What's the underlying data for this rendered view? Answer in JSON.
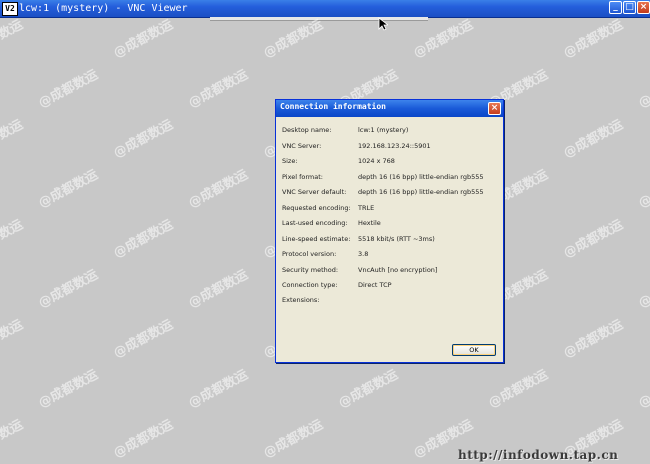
{
  "window": {
    "app_icon_text": "V2",
    "title": "lcw:1 (mystery) - VNC Viewer",
    "buttons": {
      "minimize": "_",
      "maximize": "□",
      "close": "×"
    }
  },
  "dialog": {
    "title": "Connection information",
    "close_glyph": "×",
    "rows": [
      {
        "label": "Desktop name:",
        "value": "lcw:1 (mystery)"
      },
      {
        "label": "VNC Server:",
        "value": "192.168.123.24::5901"
      },
      {
        "label": "Size:",
        "value": "1024 x 768"
      },
      {
        "label": "Pixel format:",
        "value": "depth 16 (16 bpp) little-endian rgb555"
      },
      {
        "label": "VNC Server default:",
        "value": "depth 16 (16 bpp) little-endian rgb555"
      },
      {
        "label": "Requested encoding:",
        "value": "TRLE"
      },
      {
        "label": "Last-used encoding:",
        "value": "Hextile"
      },
      {
        "label": "Line-speed estimate:",
        "value": "5518 kbit/s (RTT ~3ms)"
      },
      {
        "label": "Protocol version:",
        "value": "3.8"
      },
      {
        "label": "Security method:",
        "value": "VncAuth [no encryption]"
      },
      {
        "label": "Connection type:",
        "value": "Direct TCP"
      },
      {
        "label": "Extensions:",
        "value": ""
      }
    ],
    "ok_label": "OK"
  },
  "watermark_text": "@成都数运",
  "footer_url": "http://infodown.tap.cn"
}
